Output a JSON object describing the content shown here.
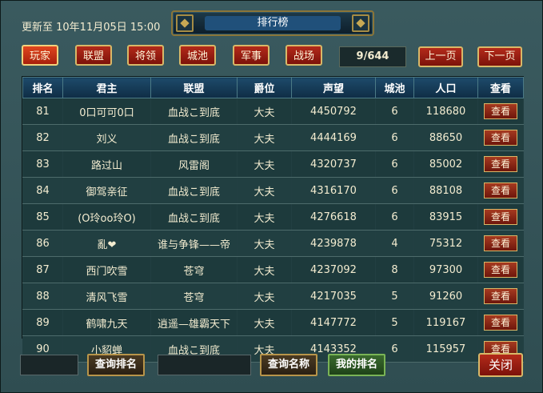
{
  "header": {
    "update_label": "更新至 10年11月05日 15:00",
    "title": "排行榜"
  },
  "tabs": [
    {
      "label": "玩家",
      "active": true
    },
    {
      "label": "联盟"
    },
    {
      "label": "将领"
    },
    {
      "label": "城池"
    },
    {
      "label": "军事"
    },
    {
      "label": "战场"
    }
  ],
  "pager": {
    "page_text": "9/644",
    "prev_label": "上一页",
    "next_label": "下一页"
  },
  "table": {
    "columns": [
      "排名",
      "君主",
      "联盟",
      "爵位",
      "声望",
      "城池",
      "人口",
      "查看"
    ],
    "rows": [
      {
        "rank": "81",
        "lord": "0口可可0口",
        "alliance": "血战こ到底",
        "title": "大夫",
        "prestige": "4450792",
        "cities": "6",
        "population": "118680",
        "action": "查看"
      },
      {
        "rank": "82",
        "lord": "刘义",
        "alliance": "血战こ到底",
        "title": "大夫",
        "prestige": "4444169",
        "cities": "6",
        "population": "88650",
        "action": "查看"
      },
      {
        "rank": "83",
        "lord": "路过山",
        "alliance": "风雷阁",
        "title": "大夫",
        "prestige": "4320737",
        "cities": "6",
        "population": "85002",
        "action": "查看"
      },
      {
        "rank": "84",
        "lord": "御驾亲征",
        "alliance": "血战こ到底",
        "title": "大夫",
        "prestige": "4316170",
        "cities": "6",
        "population": "88108",
        "action": "查看"
      },
      {
        "rank": "85",
        "lord": "(O玲oo玲O)",
        "alliance": "血战こ到底",
        "title": "大夫",
        "prestige": "4276618",
        "cities": "6",
        "population": "83915",
        "action": "查看"
      },
      {
        "rank": "86",
        "lord": "亂❤",
        "alliance": "谁与争锋——帝",
        "title": "大夫",
        "prestige": "4239878",
        "cities": "4",
        "population": "75312",
        "action": "查看"
      },
      {
        "rank": "87",
        "lord": "西门吹雪",
        "alliance": "苍穹",
        "title": "大夫",
        "prestige": "4237092",
        "cities": "8",
        "population": "97300",
        "action": "查看"
      },
      {
        "rank": "88",
        "lord": "清风飞雪",
        "alliance": "苍穹",
        "title": "大夫",
        "prestige": "4217035",
        "cities": "5",
        "population": "91260",
        "action": "查看"
      },
      {
        "rank": "89",
        "lord": "鹤啸九天",
        "alliance": "逍遥—雄霸天下",
        "title": "大夫",
        "prestige": "4147772",
        "cities": "5",
        "population": "119167",
        "action": "查看"
      },
      {
        "rank": "90",
        "lord": "小貂蝉",
        "alliance": "血战こ到底",
        "title": "大夫",
        "prestige": "4143352",
        "cities": "6",
        "population": "115957",
        "action": "查看"
      }
    ]
  },
  "footer": {
    "rank_query_value": "",
    "query_rank_label": "查询排名",
    "name_query_value": "",
    "query_name_label": "查询名称",
    "my_rank_label": "我的排名",
    "close_label": "关闭"
  }
}
